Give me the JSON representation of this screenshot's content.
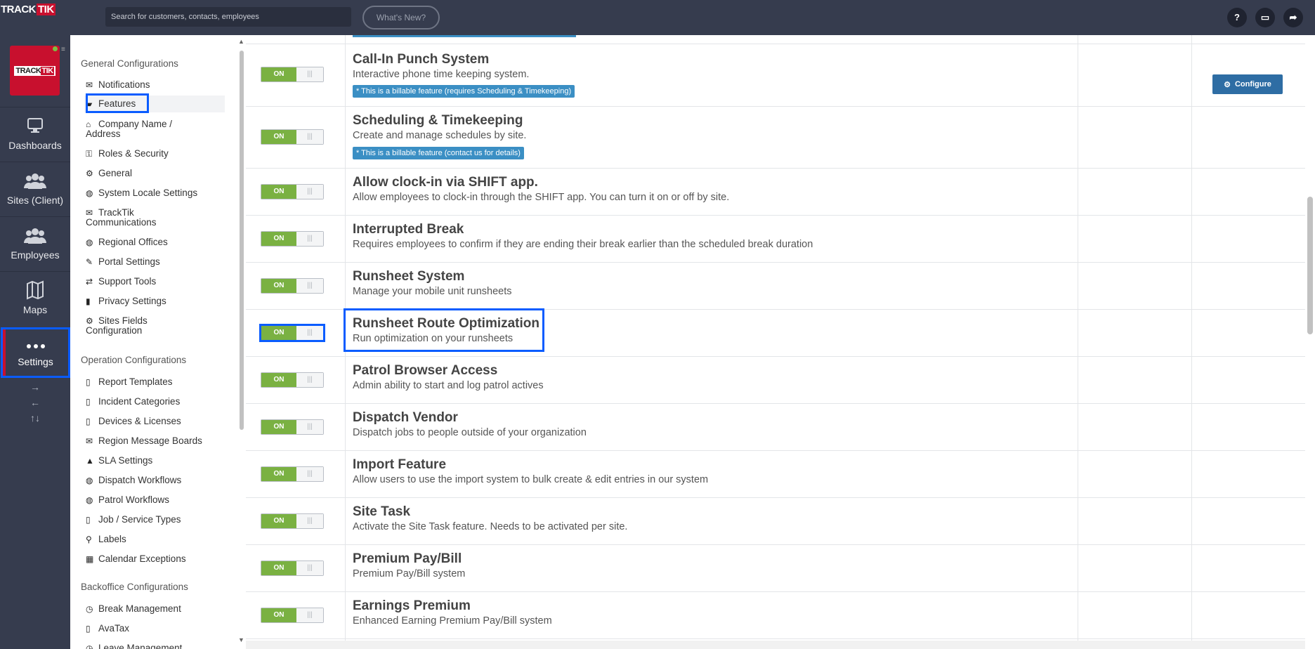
{
  "topbar": {
    "logo_a": "TRACK",
    "logo_b": "TIK",
    "search_placeholder": "Search for customers, contacts, employees",
    "whats_new": "What's New?",
    "help_icon": "?",
    "monitor_icon": "▭",
    "share_icon": "➦"
  },
  "leftnav": {
    "logo_a": "TRACK",
    "logo_b": "TIK",
    "items": [
      {
        "label": "Dashboards",
        "icon": "monitor-icon"
      },
      {
        "label": "Sites (Client)",
        "icon": "users-icon"
      },
      {
        "label": "Employees",
        "icon": "users-icon"
      },
      {
        "label": "Maps",
        "icon": "map-icon"
      },
      {
        "label": "Settings",
        "icon": "dots-icon"
      }
    ],
    "arrows": [
      "→",
      "←",
      "↑↓"
    ]
  },
  "menu": {
    "sections": [
      "General Configurations",
      "Operation Configurations",
      "Backoffice Configurations"
    ],
    "general": [
      {
        "icon": "✉",
        "label": "Notifications"
      },
      {
        "icon": "▰",
        "label": "Features"
      },
      {
        "icon": "⌂",
        "label": "Company Name /",
        "label2": "Address"
      },
      {
        "icon": "⚿",
        "label": "Roles & Security"
      },
      {
        "icon": "⚙",
        "label": "General"
      },
      {
        "icon": "◍",
        "label": "System Locale Settings"
      },
      {
        "icon": "✉",
        "label": "TrackTik",
        "label2": "Communications"
      },
      {
        "icon": "◍",
        "label": "Regional Offices"
      },
      {
        "icon": "✎",
        "label": "Portal Settings"
      },
      {
        "icon": "⇄",
        "label": "Support Tools"
      },
      {
        "icon": "▮",
        "label": "Privacy Settings"
      },
      {
        "icon": "⚙",
        "label": "Sites Fields",
        "label2": "Configuration"
      }
    ],
    "operation": [
      {
        "icon": "▯",
        "label": "Report Templates"
      },
      {
        "icon": "▯",
        "label": "Incident Categories"
      },
      {
        "icon": "▯",
        "label": "Devices & Licenses"
      },
      {
        "icon": "✉",
        "label": "Region Message Boards"
      },
      {
        "icon": "▲",
        "label": "SLA Settings"
      },
      {
        "icon": "◍",
        "label": "Dispatch Workflows"
      },
      {
        "icon": "◍",
        "label": "Patrol Workflows"
      },
      {
        "icon": "▯",
        "label": "Job / Service Types"
      },
      {
        "icon": "⚲",
        "label": "Labels"
      },
      {
        "icon": "▦",
        "label": "Calendar Exceptions"
      }
    ],
    "backoffice": [
      {
        "icon": "◷",
        "label": "Break Management"
      },
      {
        "icon": "▯",
        "label": "AvaTax"
      },
      {
        "icon": "◷",
        "label": "Leave Management"
      }
    ]
  },
  "toggle": {
    "on": "ON",
    "off": "|||"
  },
  "configure_label": "Configure",
  "features": [
    {
      "title": "Call-In Punch System",
      "desc": "Interactive phone time keeping system.",
      "billable": "* This is a billable feature (requires Scheduling & Timekeeping)",
      "configurable": true
    },
    {
      "title": "Scheduling & Timekeeping",
      "desc": "Create and manage schedules by site.",
      "billable": "* This is a billable feature (contact us for details)"
    },
    {
      "title": "Allow clock-in via SHIFT app.",
      "desc": "Allow employees to clock-in through the SHIFT app. You can turn it on or off by site."
    },
    {
      "title": "Interrupted Break",
      "desc": "Requires employees to confirm if they are ending their break earlier than the scheduled break duration"
    },
    {
      "title": "Runsheet System",
      "desc": "Manage your mobile unit runsheets"
    },
    {
      "title": "Runsheet Route Optimization",
      "desc": "Run optimization on your runsheets",
      "highlighted": true
    },
    {
      "title": "Patrol Browser Access",
      "desc": "Admin ability to start and log patrol actives"
    },
    {
      "title": "Dispatch Vendor",
      "desc": "Dispatch jobs to people outside of your organization"
    },
    {
      "title": "Import Feature",
      "desc": "Allow users to use the import system to bulk create & edit entries in our system"
    },
    {
      "title": "Site Task",
      "desc": "Activate the Site Task feature. Needs to be activated per site."
    },
    {
      "title": "Premium Pay/Bill",
      "desc": "Premium Pay/Bill system"
    },
    {
      "title": "Earnings Premium",
      "desc": "Enhanced Earning Premium Pay/Bill system"
    }
  ],
  "colors": {
    "toggle_on": "#7ab142",
    "highlight": "#0a5cff",
    "billable": "#3b8fc4",
    "nav_bg": "#363c4e",
    "brand_red": "#c8102e"
  }
}
